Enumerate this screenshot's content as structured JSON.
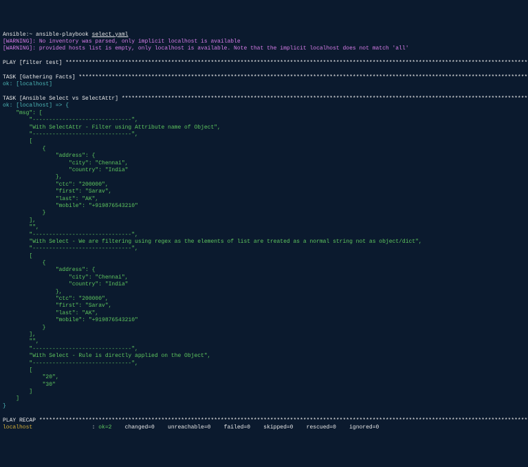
{
  "prompt": {
    "prefix": "Ansible:~ ",
    "command": "ansible-playbook ",
    "file": "select.yaml"
  },
  "warnings": {
    "w1_label": "[WARNING]: ",
    "w1_text": "No inventory was parsed, only implicit localhost is available",
    "w2_label": "[WARNING]: ",
    "w2_text": "provided hosts list is empty, only localhost is available. Note that the implicit localhost does not match 'all'"
  },
  "plays": {
    "filter_test": "PLAY [filter test] ",
    "gathering": "TASK [Gathering Facts] ",
    "gathering_ok": "ok: [localhost]",
    "selectattr": "TASK [Ansible Select vs SelectAttr] ",
    "selectattr_ok": "ok: [localhost] => {",
    "recap": "PLAY RECAP "
  },
  "output": {
    "msg_open": "    \"msg\": [",
    "sep1": "        \"------------------------------\",",
    "line_selectattr": "        \"With SelectAttr - Filter using Attribute name of Object\",",
    "sep2": "        \"------------------------------\",",
    "open_bracket1": "        [",
    "open_brace1": "            {",
    "addr_open1": "                \"address\": {",
    "city1": "                    \"city\": \"Chennai\",",
    "country1": "                    \"country\": \"India\"",
    "addr_close1": "                },",
    "ctc1": "                \"ctc\": \"200000\",",
    "first1": "                \"first\": \"Sarav\",",
    "last1": "                \"last\": \"AK\",",
    "mobile1": "                \"mobile\": \"+919876543210\"",
    "close_brace1": "            }",
    "close_bracket1": "        ],",
    "empty1": "        \"\",",
    "sep3": "        \"------------------------------\",",
    "line_select": "        \"With Select - We are filtering using regex as the elements of list are treated as a normal string not as object/dict\",",
    "sep4": "        \"------------------------------\",",
    "open_bracket2": "        [",
    "open_brace2": "            {",
    "addr_open2": "                \"address\": {",
    "city2": "                    \"city\": \"Chennai\",",
    "country2": "                    \"country\": \"India\"",
    "addr_close2": "                },",
    "ctc2": "                \"ctc\": \"200000\",",
    "first2": "                \"first\": \"Sarav\",",
    "last2": "                \"last\": \"AK\",",
    "mobile2": "                \"mobile\": \"+919876543210\"",
    "close_brace2": "            }",
    "close_bracket2": "        ],",
    "empty2": "        \"\",",
    "sep5": "        \"------------------------------\",",
    "line_rule": "        \"With Select - Rule is directly applied on the Object\",",
    "sep6": "        \"------------------------------\",",
    "open_bracket3": "        [",
    "val20": "            \"20\",",
    "val30": "            \"30\"",
    "close_bracket3": "        ]",
    "msg_close": "    ]",
    "brace_close": "}"
  },
  "recap": {
    "host": "localhost",
    "ok": "ok=2",
    "rest": "    changed=0    unreachable=0    failed=0    skipped=0    rescued=0    ignored=0"
  },
  "stars": {
    "play1": "****************************************************************************************************************************************************************",
    "task1": "************************************************************************************************************************************************************",
    "task2": "***********************************************************************************************************************************************",
    "recap": "********************************************************************************************************************************************************************"
  }
}
